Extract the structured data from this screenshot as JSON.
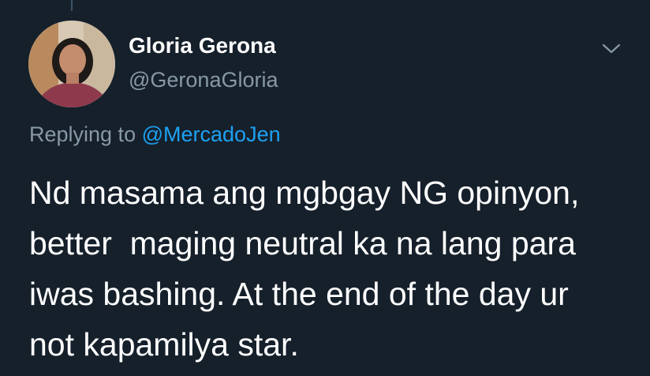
{
  "tweet": {
    "author": {
      "display_name": "Gloria Gerona",
      "handle": "@GeronaGloria"
    },
    "reply_prefix": "Replying to",
    "reply_to": "@MercadoJen",
    "text_lines": [
      "Nd masama ang mgbgay NG opinyon,",
      "better  maging neutral ka na lang para",
      "iwas bashing. At the end of the day ur",
      "not kapamilya star."
    ]
  },
  "icons": {
    "menu": "chevron-down-icon",
    "avatar": "profile-photo"
  },
  "colors": {
    "background": "#15202b",
    "primary_text": "#ffffff",
    "secondary_text": "#8899a6",
    "link": "#1da1f2"
  }
}
